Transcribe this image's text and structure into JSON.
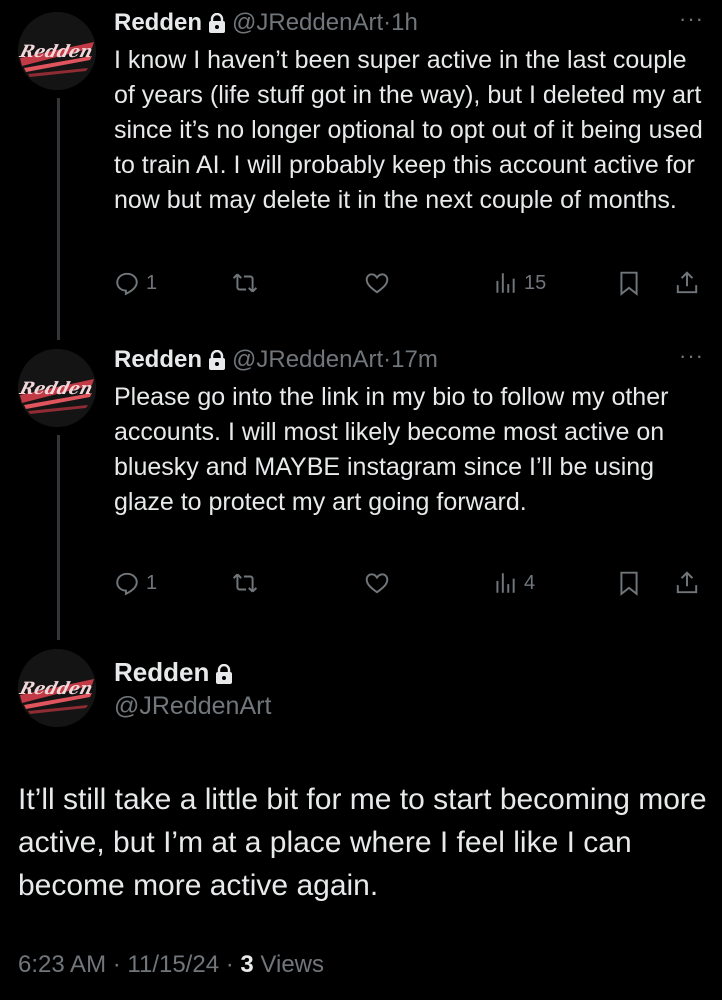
{
  "tweets": [
    {
      "name": "Redden",
      "handle": "@JReddenArt",
      "separator": "·",
      "time": "1h",
      "more": "···",
      "text": "I know I haven’t been super active in the last couple of years (life stuff got in the way), but I deleted my art since it’s no longer optional to opt out of it being used to train AI. I will probably keep this account active for now but may delete it in the next couple of months.",
      "replies": "1",
      "views": "15"
    },
    {
      "name": "Redden",
      "handle": "@JReddenArt",
      "separator": "·",
      "time": "17m",
      "more": "···",
      "text": "Please go into the link in my bio to follow my other accounts. I will most likely become most active on bluesky and MAYBE instagram since I’ll be using glaze to protect my art going forward.",
      "replies": "1",
      "views": "4"
    }
  ],
  "main": {
    "name": "Redden",
    "handle": "@JReddenArt",
    "text": "It’ll still take a little bit for me to start becoming more active, but I’m at a place where I feel like I can become more active again.",
    "time": "6:23 AM",
    "sep1": "·",
    "date": "11/15/24",
    "sep2": "·",
    "views_count": "3",
    "views_label": "Views"
  },
  "avatar_text": "Redden",
  "colors": {
    "background": "#000000",
    "text": "#e7e9ea",
    "muted": "#71767b",
    "avatar_accent": "#e0545e"
  }
}
